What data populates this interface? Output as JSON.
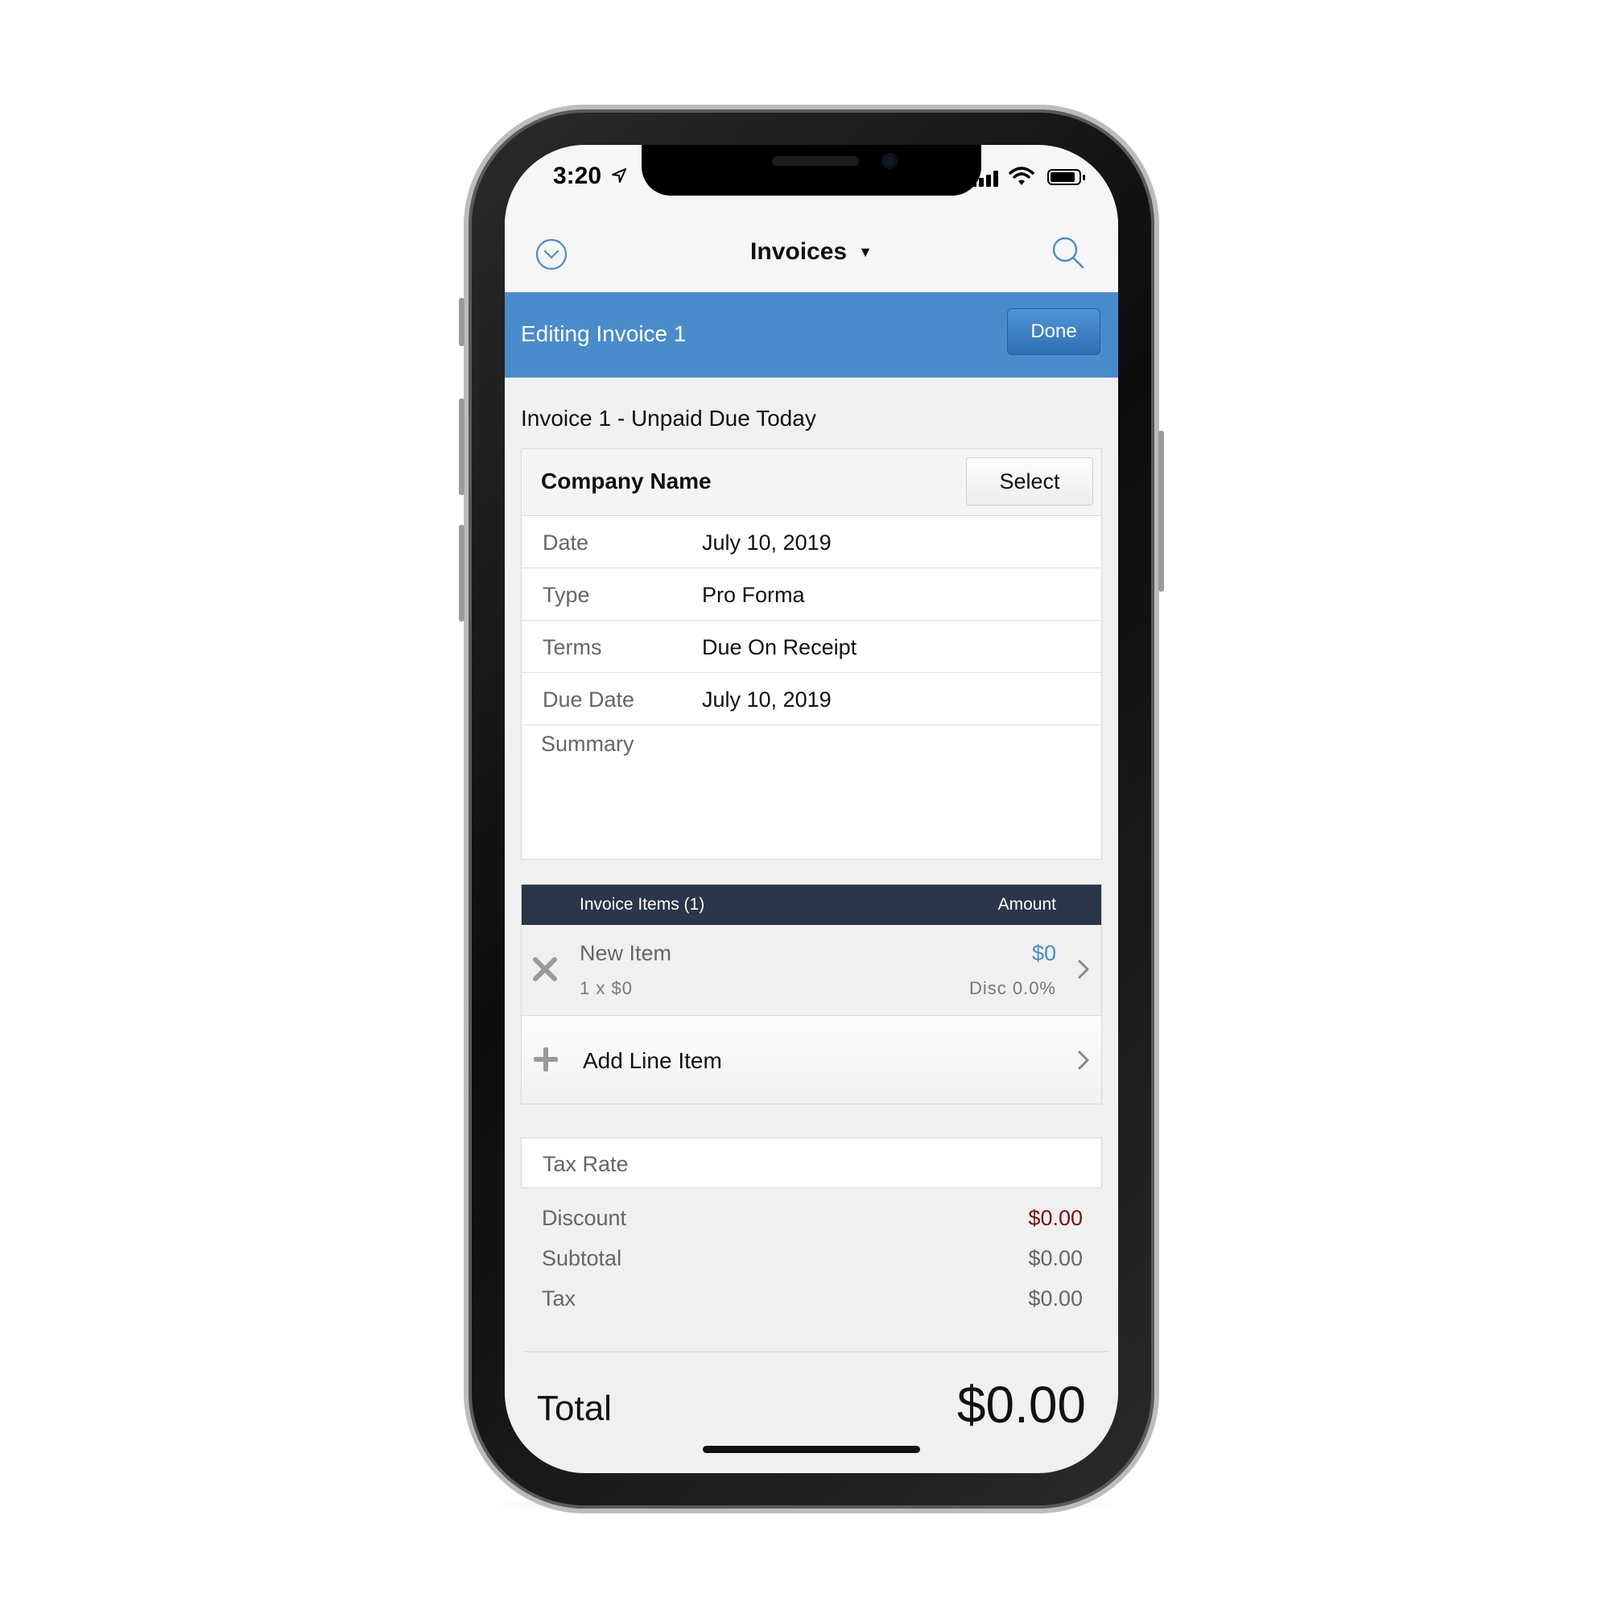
{
  "status_bar": {
    "time": "3:20"
  },
  "nav": {
    "title": "Invoices"
  },
  "edit_bar": {
    "title": "Editing Invoice 1",
    "done_label": "Done"
  },
  "invoice_status": "Invoice 1 - Unpaid Due Today",
  "company": {
    "label": "Company Name",
    "select_label": "Select"
  },
  "fields": [
    {
      "label": "Date",
      "value": "July 10, 2019"
    },
    {
      "label": "Type",
      "value": "Pro Forma"
    },
    {
      "label": "Terms",
      "value": "Due On Receipt"
    },
    {
      "label": "Due Date",
      "value": "July 10, 2019"
    }
  ],
  "summary_label": "Summary",
  "items": {
    "header_label": "Invoice Items (1)",
    "amount_header": "Amount",
    "rows": [
      {
        "name": "New Item",
        "qty": "1 x $0",
        "amount": "$0",
        "discount": "Disc 0.0%"
      }
    ],
    "add_label": "Add Line Item"
  },
  "tax_rate_label": "Tax Rate",
  "totals": {
    "discount_label": "Discount",
    "discount_value": "$0.00",
    "subtotal_label": "Subtotal",
    "subtotal_value": "$0.00",
    "tax_label": "Tax",
    "tax_value": "$0.00",
    "total_label": "Total",
    "total_value": "$0.00"
  },
  "colors": {
    "accent": "#4a8ccb",
    "header_dark": "#2a3649",
    "discount_red": "#7a1111",
    "background": "#f0f0f0"
  },
  "icons": {
    "nav_left": "chevron-down-circle-icon",
    "nav_right": "search-icon",
    "item_delete": "close-x-icon",
    "item_add": "plus-icon",
    "row_disclosure": "chevron-right-icon"
  }
}
